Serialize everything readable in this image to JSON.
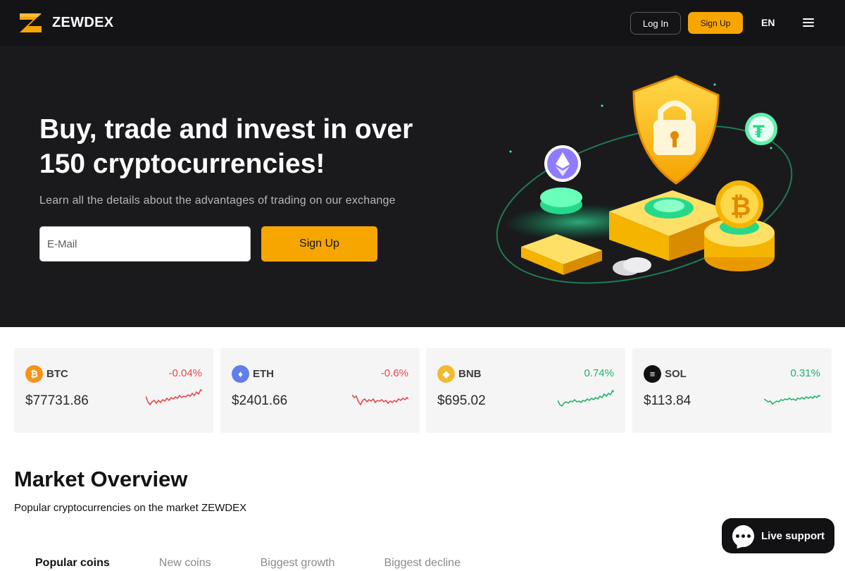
{
  "header": {
    "brand": "ZEWDEX",
    "logo_icon": "zewdex-logo",
    "login_label": "Log In",
    "signup_label": "Sign Up",
    "language": "EN",
    "menu_icon": "hamburger-menu-icon"
  },
  "hero": {
    "title": "Buy, trade and invest in over 150 cryptocurrencies!",
    "subtitle": "Learn all the details about the advantages of trading on our exchange",
    "email_placeholder": "E-Mail",
    "signup_label": "Sign Up"
  },
  "tickers": [
    {
      "symbol": "BTC",
      "change": "-0.04%",
      "price": "$77731.86",
      "icon": "bitcoin-icon",
      "icon_glyph": "₿",
      "color": "#f7931a",
      "trend": "down"
    },
    {
      "symbol": "ETH",
      "change": "-0.6%",
      "price": "$2401.66",
      "icon": "ethereum-icon",
      "icon_glyph": "♦",
      "color": "#627eea",
      "trend": "down"
    },
    {
      "symbol": "BNB",
      "change": "0.74%",
      "price": "$695.02",
      "icon": "bnb-icon",
      "icon_glyph": "◆",
      "color": "#f3ba2f",
      "trend": "up"
    },
    {
      "symbol": "SOL",
      "change": "0.31%",
      "price": "$113.84",
      "icon": "solana-icon",
      "icon_glyph": "≡",
      "color": "#121214",
      "trend": "up"
    }
  ],
  "market": {
    "title": "Market Overview",
    "subtitle": "Popular cryptocurrencies on the market ZEWDEX",
    "tabs": [
      "Popular coins",
      "New coins",
      "Biggest growth",
      "Biggest decline"
    ]
  },
  "live_support": {
    "label": "Live support",
    "icon": "chat-icon"
  },
  "colors": {
    "accent": "#f7a600",
    "header_bg": "#141416",
    "hero_bg": "#1a1a1c",
    "negative": "#e5484d",
    "positive": "#20b26c"
  }
}
